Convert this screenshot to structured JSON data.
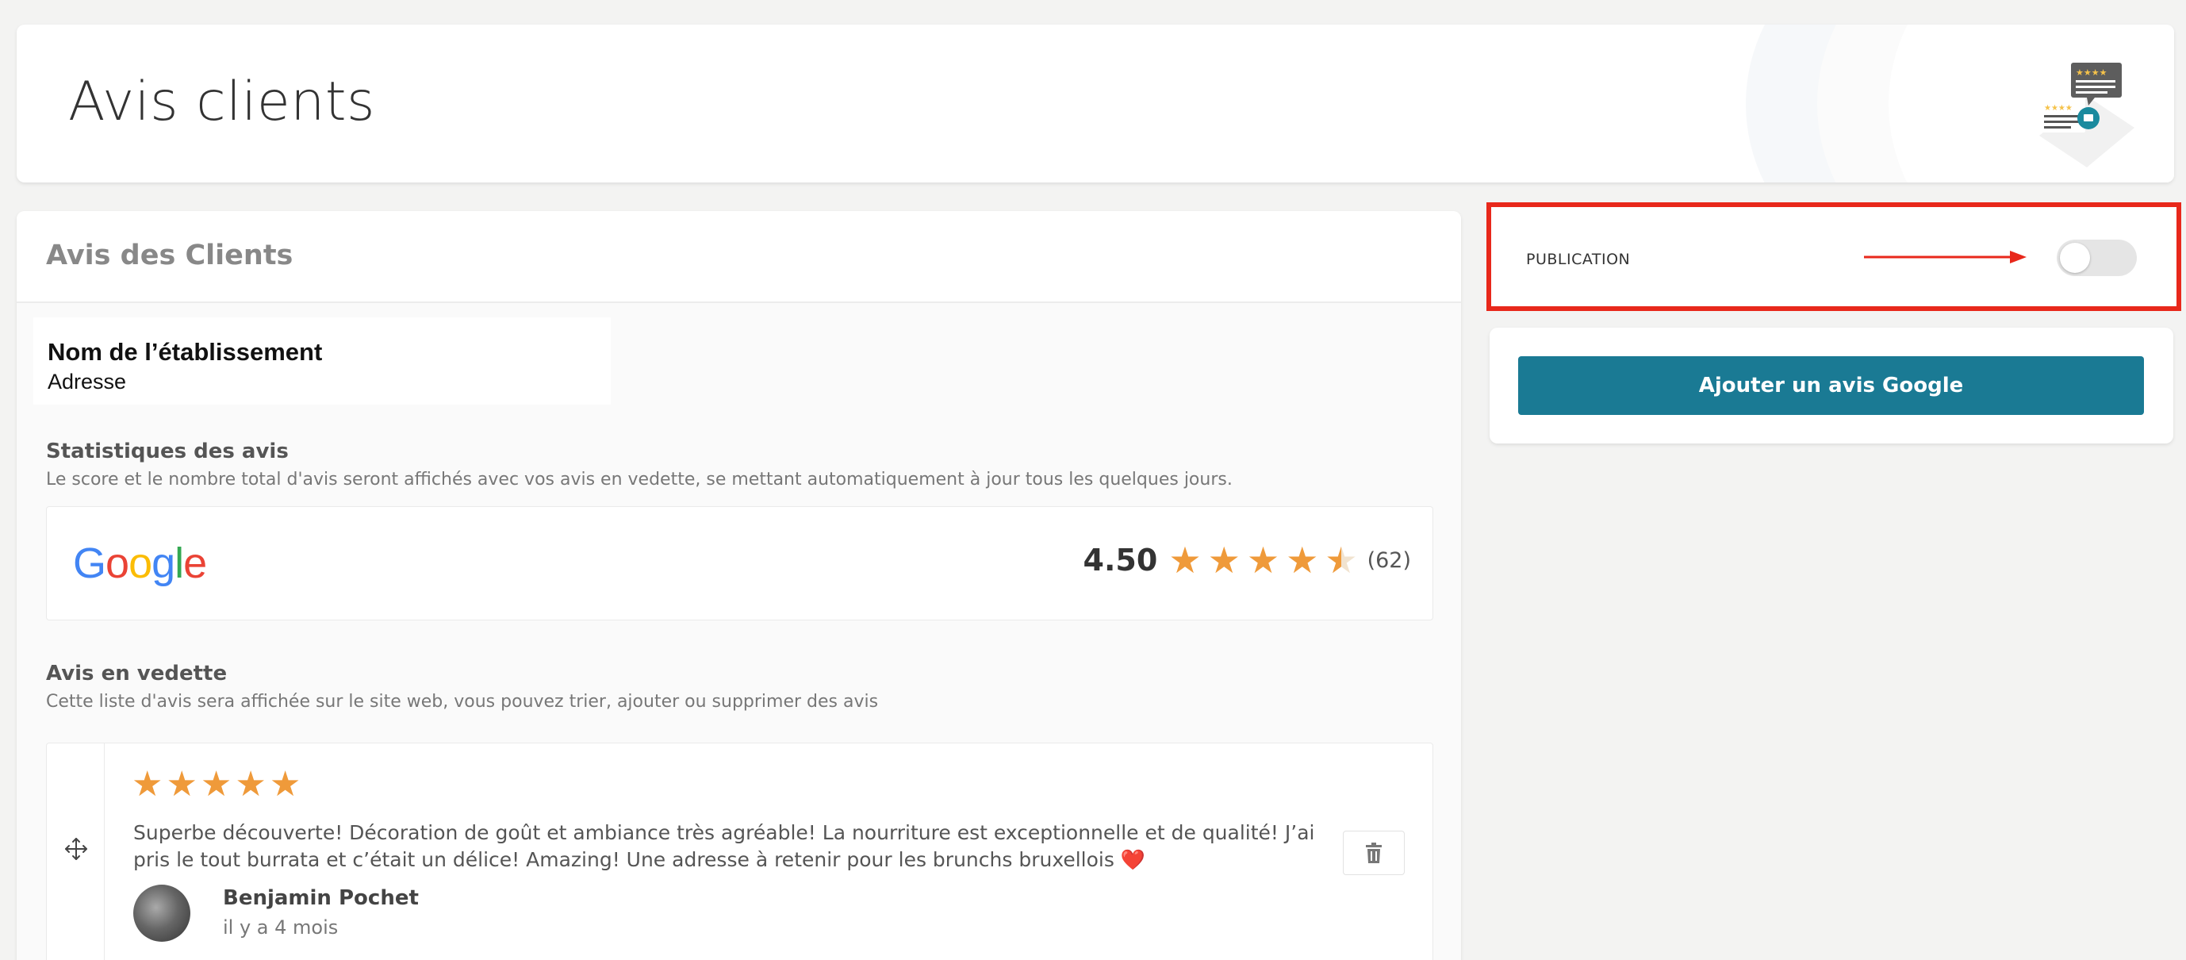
{
  "header": {
    "title": "Avis clients",
    "icon": "reviews-illustration-icon"
  },
  "main": {
    "title": "Avis des Clients",
    "establishment": {
      "name": "Nom de l’établissement",
      "address": "Adresse"
    },
    "stats": {
      "title": "Statistiques des avis",
      "description": "Le score et le nombre total d'avis seront affichés avec vos avis en vedette, se mettant automatiquement à jour tous les quelques jours.",
      "provider": "Google",
      "score": "4.50",
      "stars": 4.5,
      "count": "(62)"
    },
    "featured": {
      "title": "Avis en vedette",
      "description": "Cette liste d'avis sera affichée sur le site web, vous pouvez trier, ajouter ou supprimer des avis",
      "reviews": [
        {
          "stars": 5,
          "text": "Superbe découverte! Décoration de goût et ambiance très agréable! La nourriture est exceptionnelle et de qualité! J’ai pris le tout burrata et c’était un délice! Amazing! Une adresse à retenir pour les brunchs bruxellois",
          "emoji": "❤️",
          "author": "Benjamin Pochet",
          "date": "il y a 4 mois"
        }
      ]
    }
  },
  "sidebar": {
    "publication_label": "PUBLICATION",
    "publication_enabled": false,
    "add_button_label": "Ajouter un avis Google"
  },
  "colors": {
    "accent": "#1a7a94",
    "star": "#ef9a3a",
    "highlight": "#e8281b"
  }
}
